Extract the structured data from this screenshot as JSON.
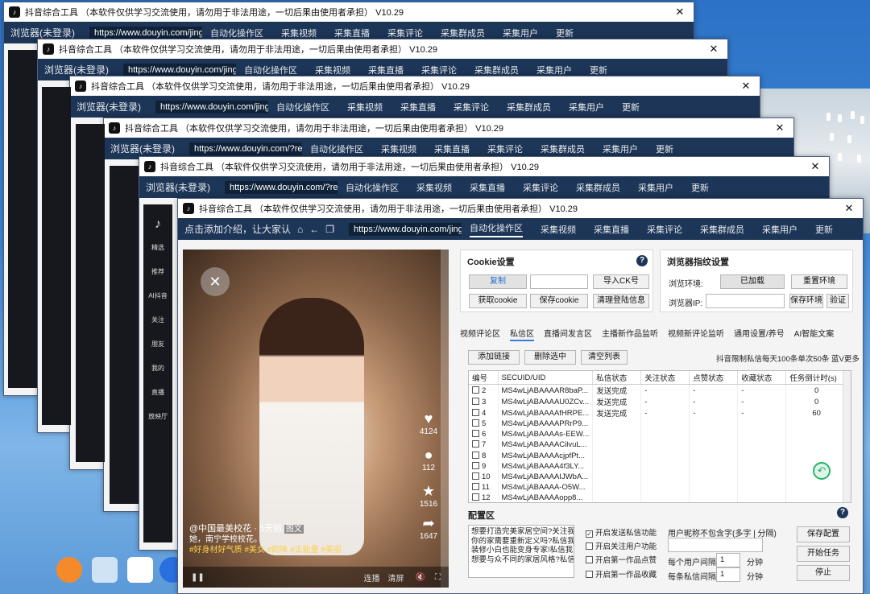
{
  "app": {
    "title": "抖音综合工具  （本软件仅供学习交流使用，请勿用于非法用途，一切后果由使用者承担）  V10.29",
    "close_glyph": "✕",
    "browser_label_back": "浏览器(未登录)",
    "browser_label_front": "点击添加介绍，让大家认",
    "url_a": "https://www.douyin.com/jingxuan",
    "url_b": "https://www.douyin.com/?recom",
    "nav_tabs": [
      "自动化操作区",
      "采集视频",
      "采集直播",
      "采集评论",
      "采集群成员",
      "采集用户",
      "更新"
    ]
  },
  "sidebar": [
    "精选",
    "推荐",
    "AI抖音",
    "关注",
    "朋友",
    "我的",
    "直播",
    "放映厅"
  ],
  "video": {
    "like_count": "4124",
    "comment_count": "112",
    "fav_count": "1516",
    "share_count": "1647",
    "author_line": "@中国最美校花 · 5天前",
    "image_tag": "图文",
    "caption": "她，南宁学校校花。",
    "tags": "#好身材好气质 #美女 #韵味 #正能量 #美丽",
    "bar_left": "连播",
    "bar_mid": "清屏"
  },
  "cookie": {
    "title": "Cookie设置",
    "copy": "复制",
    "import": "导入CK号",
    "get": "获取cookie",
    "save": "保存cookie",
    "clear": "清理登陆信息"
  },
  "browser_fp": {
    "title": "浏览器指纹设置",
    "env_label": "浏览环境:",
    "env_value": "已加载",
    "reset": "重置环境",
    "ip_label": "浏览器IP:",
    "save": "保存环境",
    "verify": "验证"
  },
  "func_tabs": [
    "视频评论区",
    "私信区",
    "直播间发言区",
    "主播新作品监听",
    "视频新评论监听",
    "通用设置/养号",
    "AI智能文案"
  ],
  "active_tab": "私信区",
  "list": {
    "add": "添加链接",
    "delete": "删除选中",
    "clear": "清空列表",
    "notice": "抖音限制私信每天100条单次50条 蓝V更多",
    "headers": [
      "编号",
      "SECUID/UID",
      "私信状态",
      "关注状态",
      "点赞状态",
      "收藏状态",
      "任务倒计时(s)"
    ],
    "rows": [
      [
        "2",
        "MS4wLjABAAAAR8baP...",
        "发送完成",
        "-",
        "-",
        "-",
        "0"
      ],
      [
        "3",
        "MS4wLjABAAAAU0ZCv...",
        "发送完成",
        "-",
        "-",
        "-",
        "0"
      ],
      [
        "4",
        "MS4wLjABAAAAfHRPE...",
        "发送完成",
        "-",
        "-",
        "-",
        "60"
      ],
      [
        "5",
        "MS4wLjABAAAAPRrP9...",
        "",
        "",
        "",
        "",
        ""
      ],
      [
        "6",
        "MS4wLjABAAAAs-EEW...",
        "",
        "",
        "",
        "",
        ""
      ],
      [
        "7",
        "MS4wLjABAAAACilvuL...",
        "",
        "",
        "",
        "",
        ""
      ],
      [
        "8",
        "MS4wLjABAAAAcjpfPt...",
        "",
        "",
        "",
        "",
        ""
      ],
      [
        "9",
        "MS4wLjABAAAA4f3LY...",
        "",
        "",
        "",
        "",
        ""
      ],
      [
        "10",
        "MS4wLjABAAAAIJWbA...",
        "",
        "",
        "",
        "",
        ""
      ],
      [
        "11",
        "MS4wLjABAAAA-O5W...",
        "",
        "",
        "",
        "",
        ""
      ],
      [
        "12",
        "MS4wLjABAAAAopp8...",
        "",
        "",
        "",
        "",
        ""
      ]
    ]
  },
  "config": {
    "title": "配置区",
    "messages": [
      "想要打造完美家居空间?关注我",
      "你的家需要重新定义吗?私信我",
      "装修小白也能变身专家!私信我",
      "想要与众不同的家居风格?私信"
    ],
    "chk_send": "开启发送私信功能",
    "chk_follow": "开启关注用户功能",
    "chk_like": "开启第一作品点赞",
    "chk_fav": "开启第一作品收藏",
    "nick_label": "用户昵称不包含字(多字 | 分隔)",
    "interval_user": "每个用户间隔",
    "interval_user_value": "1",
    "interval_msg": "每条私信间隔",
    "interval_msg_value": "1",
    "unit": "分钟",
    "save": "保存配置",
    "start": "开始任务",
    "stop": "停止"
  }
}
